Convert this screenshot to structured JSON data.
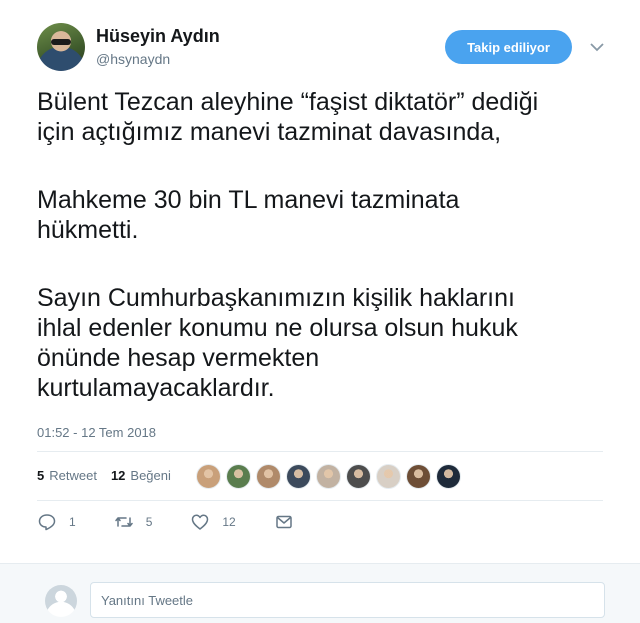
{
  "user": {
    "display_name": "Hüseyin Aydın",
    "handle": "@hsynaydn"
  },
  "follow_button": {
    "label": "Takip ediliyor"
  },
  "tweet": {
    "lines": [
      "Bülent Tezcan aleyhine “faşist diktatör” dediği",
      "için açtığımız manevi tazminat davasında,",
      "Mahkeme 30 bin TL manevi tazminata",
      "hükmetti.",
      "Sayın Cumhurbaşkanımızın kişilik haklarını",
      "ihlal edenler konumu ne olursa olsun hukuk",
      "önünde hesap vermekten",
      "kurtulamayacaklardır."
    ],
    "timestamp": "01:52 - 12 Tem 2018"
  },
  "stats": {
    "retweet_count": "5",
    "retweet_label": "Retweet",
    "like_count": "12",
    "like_label": "Beğeni"
  },
  "likers_colors": [
    "#c9a07a",
    "#5a7d4e",
    "#b08a6a",
    "#3c4a5c",
    "#c2b2a2",
    "#4d4d4d",
    "#d8cfc5",
    "#6e4e36",
    "#1e2a3a"
  ],
  "actions": {
    "reply_count": "1",
    "retweet_count": "5",
    "like_count": "12"
  },
  "reply_box": {
    "placeholder": "Yanıtını Tweetle"
  },
  "colors": {
    "accent": "#4aa3ef",
    "muted": "#657786"
  }
}
